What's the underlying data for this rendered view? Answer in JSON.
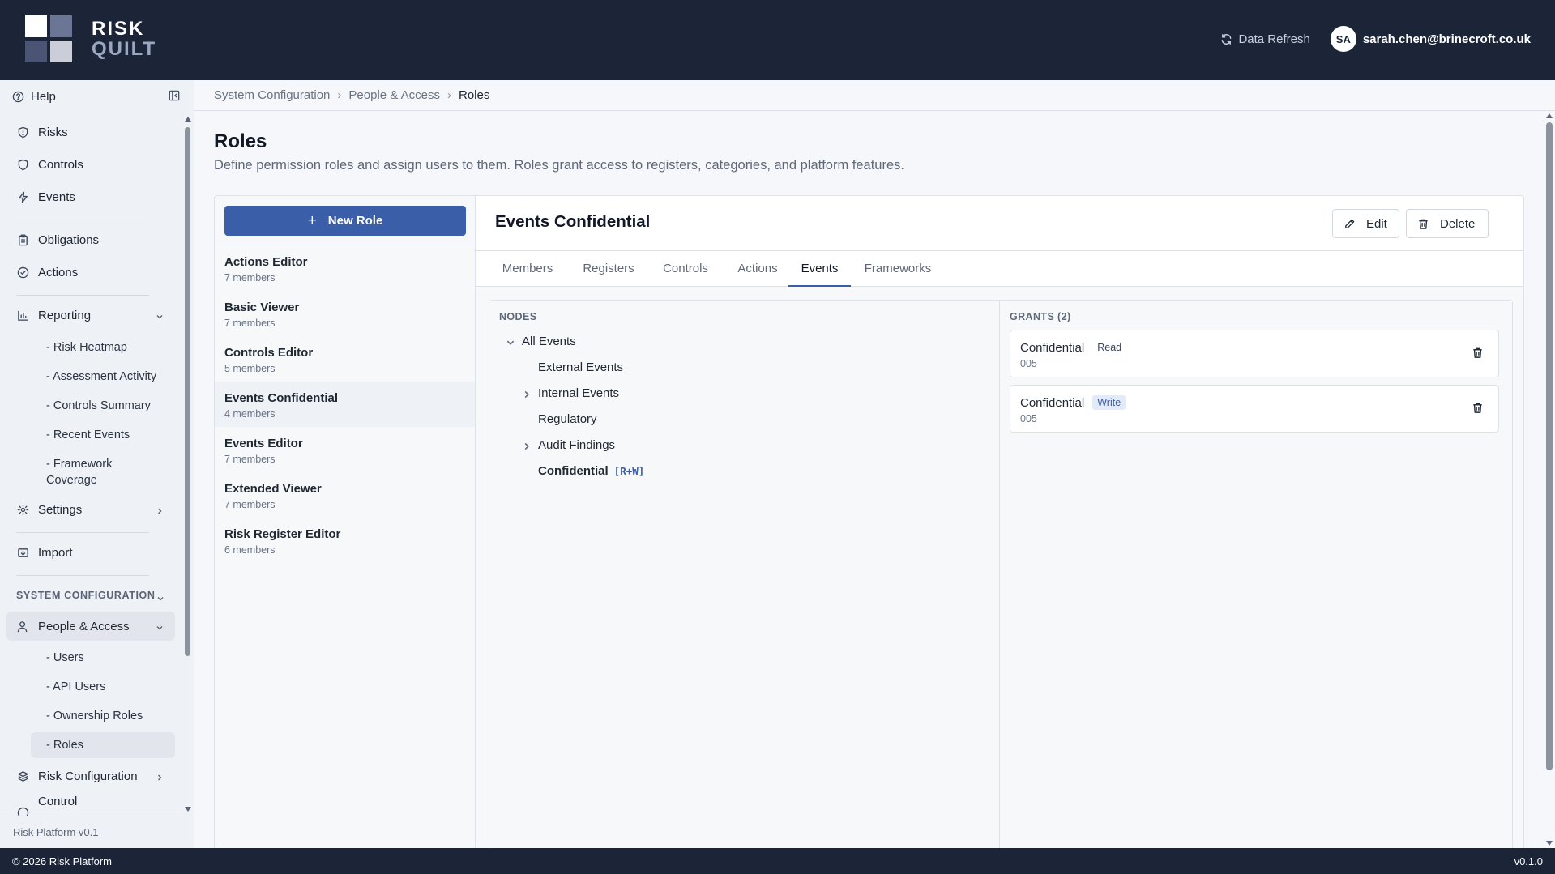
{
  "app": {
    "logo_line1": "RISK",
    "logo_line2": "QUILT",
    "data_refresh": "Data Refresh",
    "avatar_initials": "SA",
    "user_email": "sarah.chen@brinecroft.co.uk"
  },
  "sidebar": {
    "help": "Help",
    "items": {
      "risks": "Risks",
      "controls": "Controls",
      "events": "Events",
      "obligations": "Obligations",
      "actions": "Actions",
      "reporting": "Reporting",
      "settings": "Settings",
      "import": "Import",
      "people_access": "People & Access",
      "risk_configuration": "Risk Configuration",
      "control": "Control"
    },
    "reporting_subitems": [
      "- Risk Heatmap",
      "- Assessment Activity",
      "- Controls Summary",
      "- Recent Events",
      "- Framework Coverage"
    ],
    "section_system_configuration": "SYSTEM CONFIGURATION",
    "people_subitems": [
      "- Users",
      "- API Users",
      "- Ownership Roles",
      "- Roles"
    ],
    "footer": "Risk Platform v0.1"
  },
  "breadcrumb": [
    "System Configuration",
    "People & Access",
    "Roles"
  ],
  "page": {
    "title": "Roles",
    "subtitle": "Define permission roles and assign users to them. Roles grant access to registers, categories, and platform features."
  },
  "roles_panel": {
    "new_role_label": "New Role",
    "roles": [
      {
        "name": "Actions Editor",
        "members": "7 members"
      },
      {
        "name": "Basic Viewer",
        "members": "7 members"
      },
      {
        "name": "Controls Editor",
        "members": "5 members"
      },
      {
        "name": "Events Confidential",
        "members": "4 members"
      },
      {
        "name": "Events Editor",
        "members": "7 members"
      },
      {
        "name": "Extended Viewer",
        "members": "7 members"
      },
      {
        "name": "Risk Register Editor",
        "members": "6 members"
      }
    ],
    "selected_index": 3
  },
  "detail": {
    "title": "Events Confidential",
    "edit_label": "Edit",
    "delete_label": "Delete",
    "tabs": [
      "Members",
      "Registers",
      "Controls",
      "Actions",
      "Events",
      "Frameworks"
    ],
    "active_tab": "Events",
    "nodes_header": "NODES",
    "nodes": [
      {
        "label": "All Events",
        "expander": "expanded"
      },
      {
        "label": "External Events",
        "expander": "none"
      },
      {
        "label": "Internal Events",
        "expander": "collapsed"
      },
      {
        "label": "Regulatory",
        "expander": "none"
      },
      {
        "label": "Audit Findings",
        "expander": "collapsed"
      },
      {
        "label": "Confidential",
        "expander": "none",
        "tag": "[R+W]"
      }
    ],
    "grants_header": "GRANTS (2)",
    "grants": [
      {
        "name": "Confidential",
        "permission": "Read",
        "code": "005"
      },
      {
        "name": "Confidential",
        "permission": "Write",
        "code": "005"
      }
    ]
  },
  "footer": {
    "copyright": "© 2026 Risk Platform",
    "version": "v0.1.0"
  },
  "colors": {
    "header_bg": "#1c2538",
    "primary": "#3a5ea8",
    "page_bg": "#f5f7fa",
    "write_badge_bg": "#e3ebfb"
  }
}
